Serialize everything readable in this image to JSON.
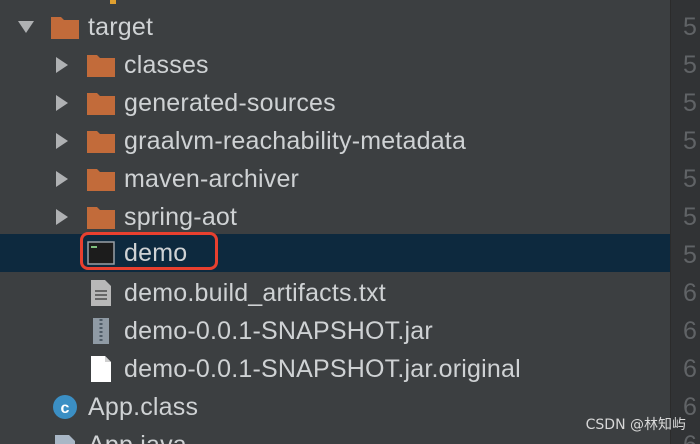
{
  "tree": {
    "items": [
      {
        "label": "target",
        "type": "folder",
        "expanded": true,
        "depth": 0
      },
      {
        "label": "classes",
        "type": "folder",
        "expanded": false,
        "depth": 1
      },
      {
        "label": "generated-sources",
        "type": "folder",
        "expanded": false,
        "depth": 1
      },
      {
        "label": "graalvm-reachability-metadata",
        "type": "folder",
        "expanded": false,
        "depth": 1
      },
      {
        "label": "maven-archiver",
        "type": "folder",
        "expanded": false,
        "depth": 1
      },
      {
        "label": "spring-aot",
        "type": "folder",
        "expanded": false,
        "depth": 1
      },
      {
        "label": "demo",
        "type": "executable",
        "selected": true,
        "depth": 1
      },
      {
        "label": "demo.build_artifacts.txt",
        "type": "text-file",
        "depth": 1
      },
      {
        "label": "demo-0.0.1-SNAPSHOT.jar",
        "type": "archive-file",
        "depth": 1
      },
      {
        "label": "demo-0.0.1-SNAPSHOT.jar.original",
        "type": "file",
        "depth": 1
      },
      {
        "label": "App.class",
        "type": "class-file",
        "depth": 0
      },
      {
        "label": "App.java",
        "type": "java-file",
        "depth": 0
      }
    ]
  },
  "gutter": {
    "numbers": [
      "5",
      "5",
      "5",
      "5",
      "5",
      "5",
      "5",
      "6",
      "6",
      "6",
      "6",
      "6"
    ]
  },
  "watermark": "CSDN @林知屿",
  "colors": {
    "background": "#3c3f41",
    "selection": "#0d293e",
    "folder": "#c26b3a",
    "highlight": "#e8402f"
  }
}
